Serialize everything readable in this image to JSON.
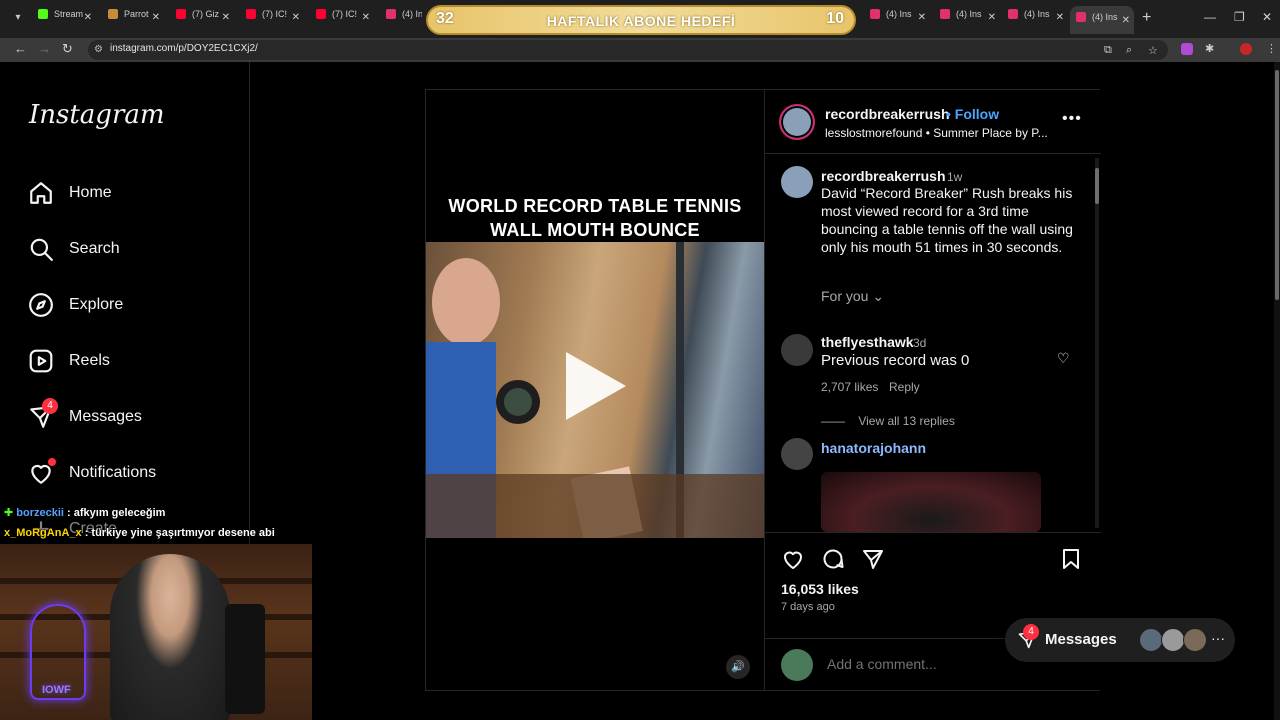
{
  "browser": {
    "tabs": [
      {
        "title": "Stream",
        "color": "#53fc18"
      },
      {
        "title": "Parrot",
        "color": "#c98a3b"
      },
      {
        "title": "(7) Giz",
        "color": "#ff0033"
      },
      {
        "title": "(7) IC!",
        "color": "#ff0033"
      },
      {
        "title": "(7) IC!",
        "color": "#ff0033"
      },
      {
        "title": "(4) Ins",
        "color": "#e1306c"
      },
      {
        "title": "(4) Ins",
        "color": "#e1306c"
      },
      {
        "title": "(4) Ins",
        "color": "#e1306c"
      },
      {
        "title": "(4) Ins",
        "color": "#e1306c"
      },
      {
        "title": "(4) Ins",
        "color": "#e1306c"
      }
    ],
    "url": "instagram.com/p/DOY2EC1CXj2/",
    "new_tab": "+"
  },
  "banner": {
    "left_num": "32",
    "label": "HAFTALIK ABONE HEDEFİ",
    "right_num": "10"
  },
  "sidebar": {
    "logo": "Instagram",
    "items": [
      {
        "label": "Home",
        "icon": "home-icon"
      },
      {
        "label": "Search",
        "icon": "search-icon"
      },
      {
        "label": "Explore",
        "icon": "compass-icon"
      },
      {
        "label": "Reels",
        "icon": "reels-icon"
      },
      {
        "label": "Messages",
        "icon": "messenger-icon",
        "badge": "4"
      },
      {
        "label": "Notifications",
        "icon": "heart-icon"
      },
      {
        "label": "Create",
        "icon": "plus-icon"
      }
    ]
  },
  "post": {
    "video_title_line1": "WORLD RECORD TABLE TENNIS",
    "video_title_line2": "WALL MOUTH BOUNCE",
    "author": "recordbreakerrush",
    "follow": "Follow",
    "subline": "lesslostmorefound • Summer Place by P...",
    "caption": {
      "user": "recordbreakerrush",
      "time": "1w",
      "text": "David “Record Breaker” Rush breaks his most viewed record for a 3rd time bouncing a table tennis off the wall using only his mouth 51 times in 30 seconds."
    },
    "for_you": "For you",
    "comments": [
      {
        "user": "theflyesthawk",
        "time": "3d",
        "text": "Previous record was 0",
        "likes": "2,707 likes",
        "reply": "Reply",
        "view_replies": "View all 13 replies"
      },
      {
        "user": "hanatorajohann"
      }
    ],
    "likes": "16,053 likes",
    "ago": "7 days ago",
    "add_comment_placeholder": "Add a comment..."
  },
  "messages_pill": {
    "label": "Messages",
    "badge": "4"
  },
  "stream_chat": [
    {
      "user": "borzeckii",
      "text": ": afkyım geleceğim",
      "color": "#5aa0ff"
    },
    {
      "user": "x_MoRgAnA_x",
      "text": ": türkiye yine şaşırtmıyor desene abi",
      "color": "#ffd400"
    }
  ],
  "webcam": {
    "neon_text": "IOWF"
  },
  "colors": {
    "accent": "#4aa3ff",
    "badge": "#ff3040",
    "bg": "#000000"
  }
}
